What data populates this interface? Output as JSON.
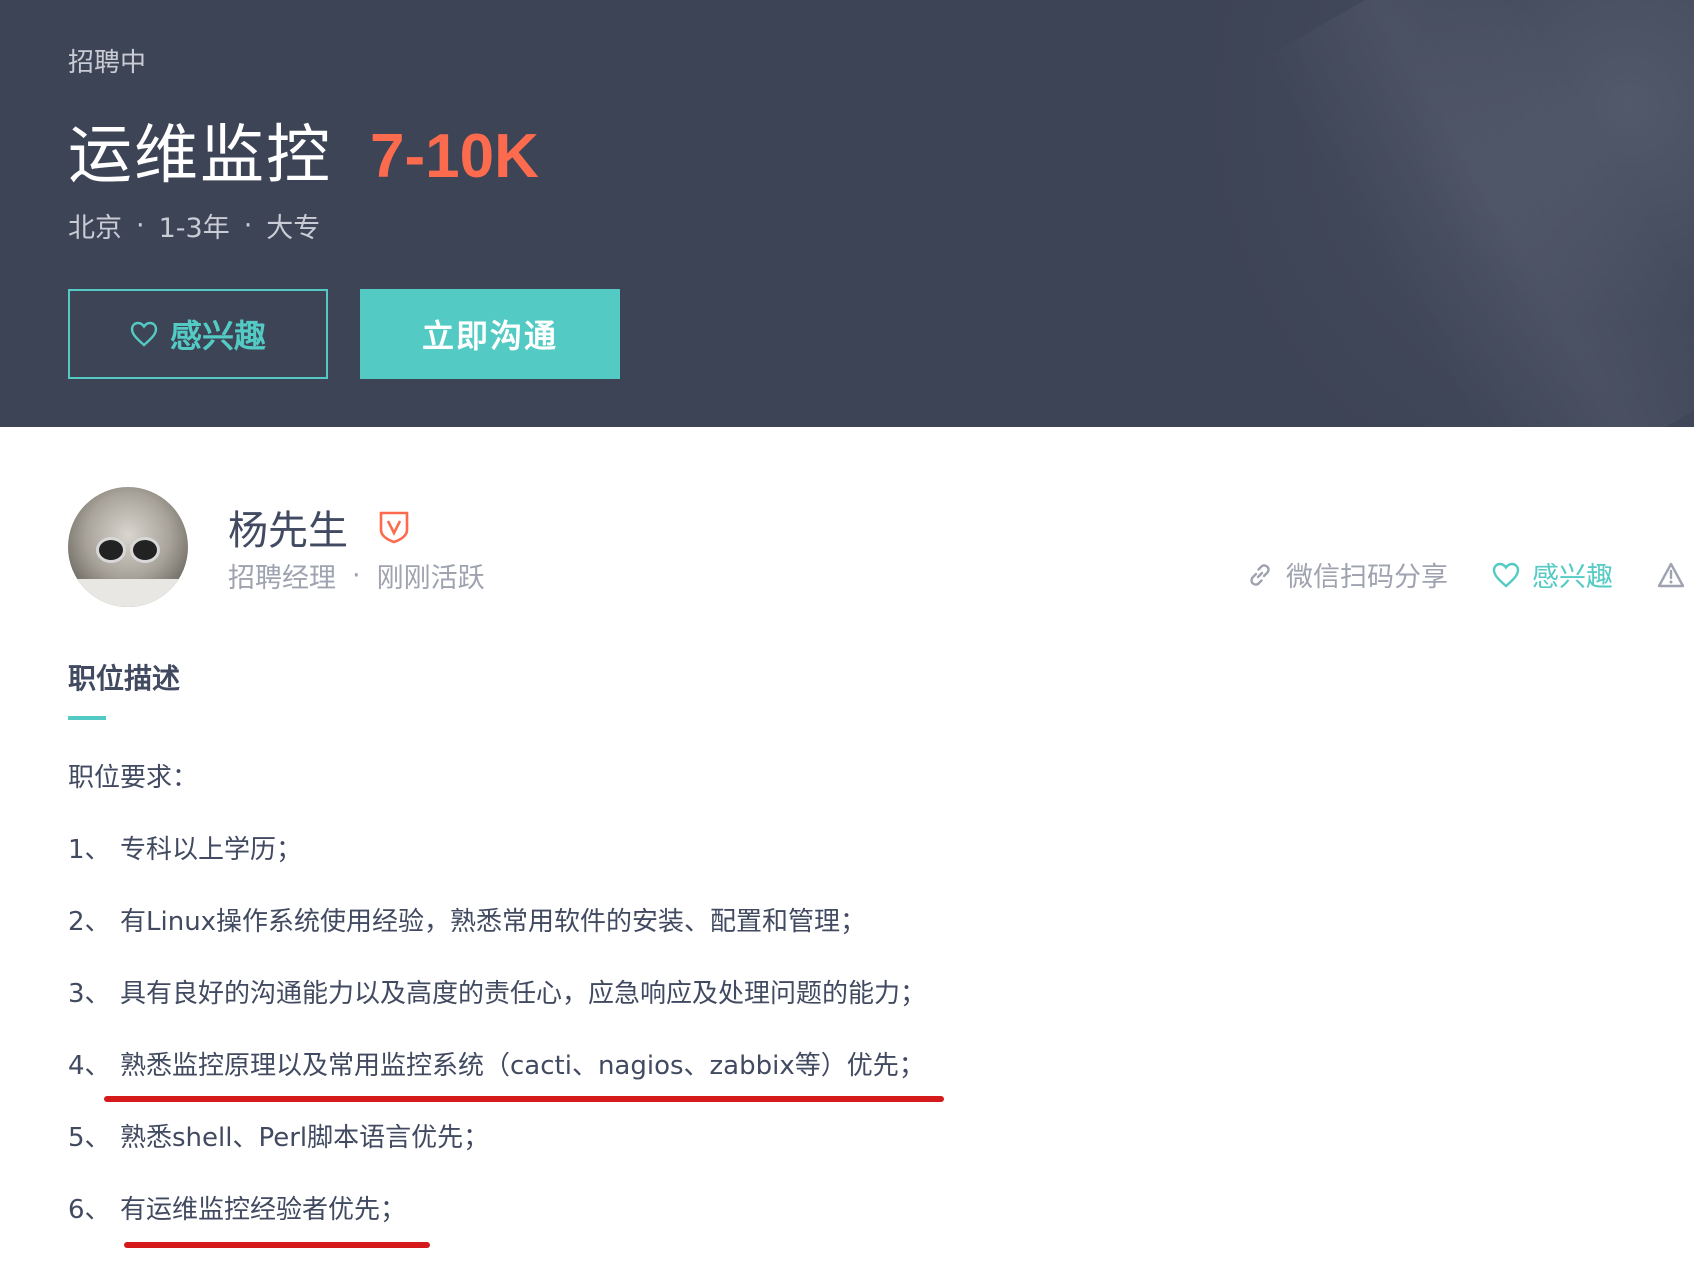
{
  "header": {
    "status": "招聘中",
    "job_title": "运维监控",
    "salary": "7-10K",
    "meta": {
      "city": "北京",
      "experience": "1-3年",
      "education": "大专",
      "separator": "·"
    },
    "interest_button": {
      "label": "感兴趣",
      "icon": "heart-icon"
    },
    "chat_button": {
      "label": "立即沟通"
    },
    "colors": {
      "background": "#3d4456",
      "accent": "#53cac3",
      "salary": "#fc6b4d"
    }
  },
  "recruiter": {
    "name": "杨先生",
    "verified_icon": "verified-shield-icon",
    "title": "招聘经理",
    "activity": "刚刚活跃",
    "separator": "·"
  },
  "actions": {
    "share": {
      "label": "微信扫码分享",
      "icon": "link-icon"
    },
    "interest": {
      "label": "感兴趣",
      "icon": "heart-icon"
    },
    "report": {
      "label": "举",
      "icon": "warning-icon"
    }
  },
  "description": {
    "section_title": "职位描述",
    "intro": "职位要求：",
    "items": [
      {
        "num": "1、",
        "text": "专科以上学历；"
      },
      {
        "num": "2、",
        "text": "有Linux操作系统使用经验，熟悉常用软件的安装、配置和管理；"
      },
      {
        "num": "3、",
        "text": "具有良好的沟通能力以及高度的责任心，应急响应及处理问题的能力；"
      },
      {
        "num": "4、",
        "text": "熟悉监控原理以及常用监控系统（cacti、nagios、zabbix等）优先；"
      },
      {
        "num": "5、",
        "text": "熟悉shell、Perl脚本语言优先；"
      },
      {
        "num": "6、",
        "text": "有运维监控经验者优先；"
      }
    ],
    "highlight_color": "#d41a1a"
  }
}
